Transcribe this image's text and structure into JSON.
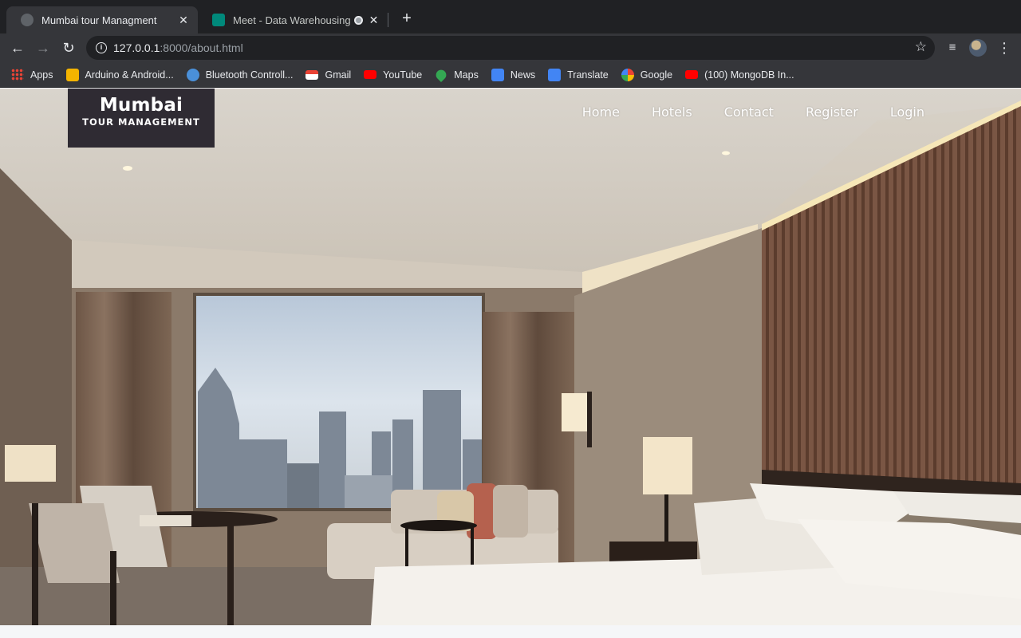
{
  "browser": {
    "tabs": [
      {
        "title": "Mumbai tour Managment",
        "active": true
      },
      {
        "title": "Meet - Data Warehousing a",
        "active": false
      }
    ],
    "url": {
      "host": "127.0.0.1",
      "path": ":8000/about.html"
    },
    "bookmarks": [
      {
        "label": "Apps",
        "icon": "apps-grid-icon"
      },
      {
        "label": "Arduino & Android...",
        "icon": "arduino-icon"
      },
      {
        "label": "Bluetooth Controll...",
        "icon": "globe-icon"
      },
      {
        "label": "Gmail",
        "icon": "gmail-icon"
      },
      {
        "label": "YouTube",
        "icon": "youtube-icon"
      },
      {
        "label": "Maps",
        "icon": "maps-icon"
      },
      {
        "label": "News",
        "icon": "news-icon"
      },
      {
        "label": "Translate",
        "icon": "translate-icon"
      },
      {
        "label": "Google",
        "icon": "google-icon"
      },
      {
        "label": "(100) MongoDB In...",
        "icon": "youtube-icon"
      }
    ]
  },
  "site": {
    "logo": {
      "title": "Mumbai",
      "subtitle": "TOUR MANAGEMENT"
    },
    "nav": [
      "Home",
      "Hotels",
      "Contact",
      "Register",
      "Login"
    ],
    "hero_image": "hotel-room-with-city-view"
  },
  "colors": {
    "logo_bg": "#2f2b33",
    "chrome_dark": "#202124",
    "chrome_toolbar": "#35363a"
  }
}
